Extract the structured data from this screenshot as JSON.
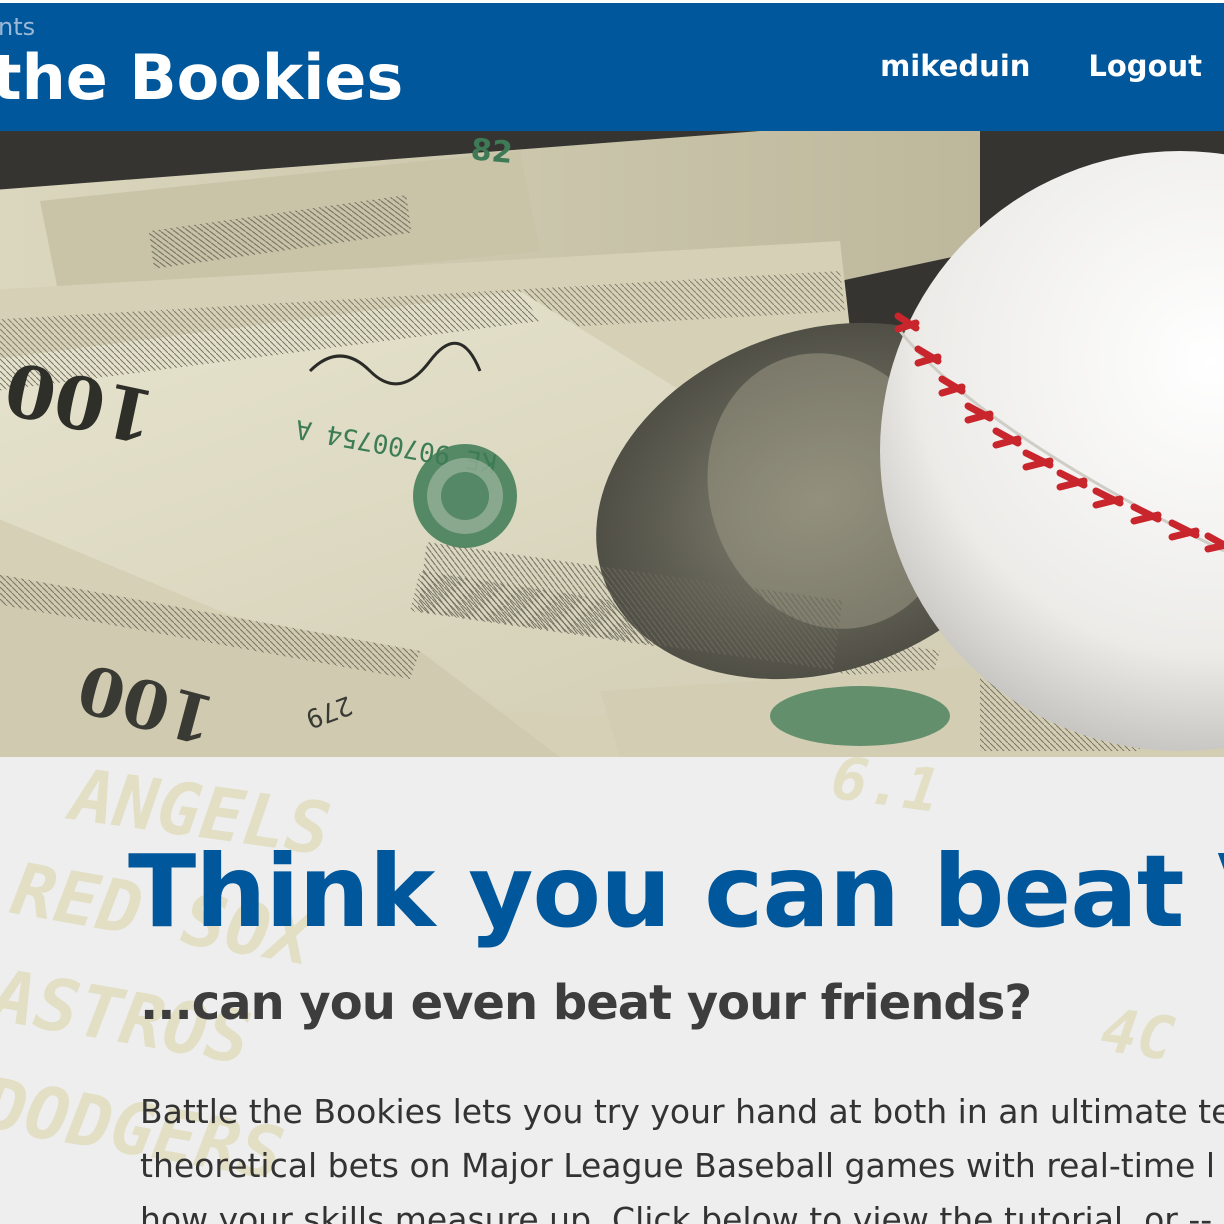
{
  "header": {
    "brand_subtitle": "nts",
    "brand_title": "the Bookies",
    "nav": {
      "user_label": "mikeduin",
      "logout_label": "Logout"
    },
    "background_color": "#01579b"
  },
  "hero": {
    "image_subject": "hundred-dollar bills with a baseball",
    "note_numbers": [
      "100",
      "KE 90700754 A",
      "279"
    ]
  },
  "intro": {
    "heading": "Think you can beat Ve",
    "subheading": "...can you even beat your friends?",
    "body_lines": [
      "Battle the Bookies lets you try your hand at both in an ultimate tes",
      "theoretical bets on Major League Baseball games with real-time l",
      "how your skills measure up. Click below to view the tutorial, or -- i"
    ],
    "background_words": [
      "ANGELS",
      "RED SOX",
      "ASTROS",
      "DODGERS"
    ],
    "heading_color": "#01579b",
    "subheading_color": "#3d3d3d"
  }
}
